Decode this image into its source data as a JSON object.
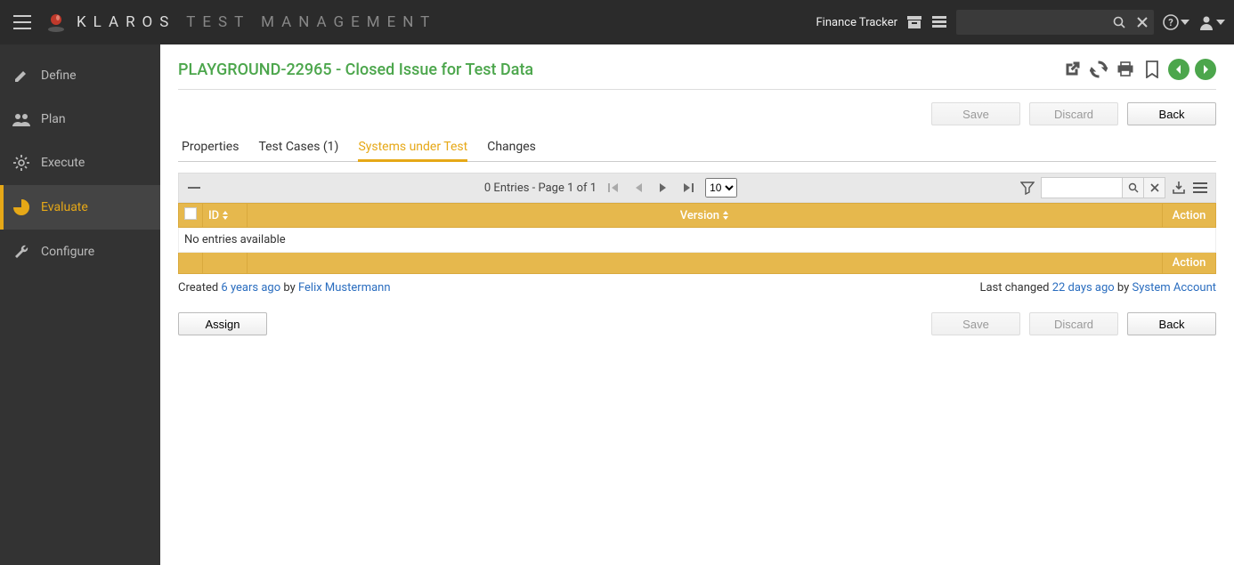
{
  "brand": {
    "primary": "KLAROS",
    "secondary": "TEST MANAGEMENT"
  },
  "topbar": {
    "project_label": "Finance Tracker",
    "search_placeholder": ""
  },
  "sidebar": {
    "items": [
      {
        "label": "Define"
      },
      {
        "label": "Plan"
      },
      {
        "label": "Execute"
      },
      {
        "label": "Evaluate"
      },
      {
        "label": "Configure"
      }
    ]
  },
  "page": {
    "title": "PLAYGROUND-22965 - Closed Issue for Test Data"
  },
  "buttons": {
    "save": "Save",
    "discard": "Discard",
    "back": "Back",
    "assign": "Assign"
  },
  "tabs": [
    {
      "label": "Properties"
    },
    {
      "label": "Test Cases (1)"
    },
    {
      "label": "Systems under Test"
    },
    {
      "label": "Changes"
    }
  ],
  "table": {
    "pager_text": "0 Entries - Page 1 of 1",
    "page_size": "10",
    "columns": {
      "id": "ID",
      "version": "Version",
      "action": "Action"
    },
    "empty_text": "No entries available",
    "footer_action": "Action"
  },
  "meta": {
    "created_prefix": "Created ",
    "created_when": "6 years ago",
    "created_by": " by ",
    "created_user": "Felix Mustermann",
    "changed_prefix": "Last changed ",
    "changed_when": "22 days ago",
    "changed_by": " by ",
    "changed_user": "System Account"
  }
}
